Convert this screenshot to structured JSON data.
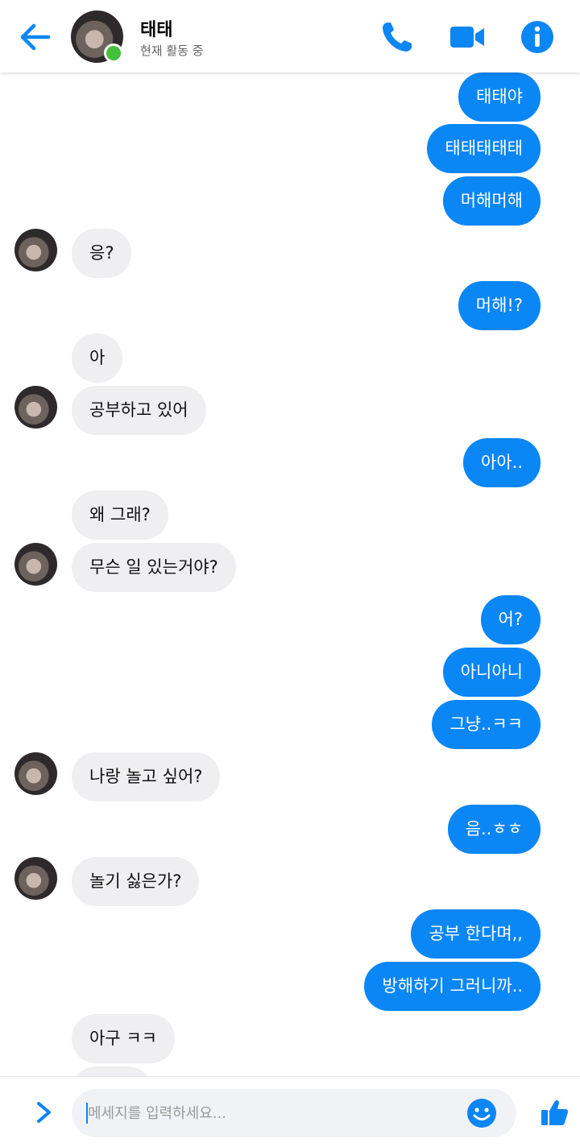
{
  "header": {
    "contact_name": "태태",
    "status": "현재 활동 중"
  },
  "messages": [
    {
      "side": "out",
      "text": "태태야"
    },
    {
      "side": "out",
      "text": "태태태태태"
    },
    {
      "side": "out",
      "text": "머해머해"
    },
    {
      "side": "in",
      "text": "응?"
    },
    {
      "side": "out",
      "text": "머해!?"
    },
    {
      "side": "in",
      "text": "아"
    },
    {
      "side": "in",
      "text": "공부하고 있어"
    },
    {
      "side": "out",
      "text": "아아.."
    },
    {
      "side": "in",
      "text": "왜 그래?"
    },
    {
      "side": "in",
      "text": "무슨 일 있는거야?"
    },
    {
      "side": "out",
      "text": "어?"
    },
    {
      "side": "out",
      "text": "아니아니"
    },
    {
      "side": "out",
      "text": "그냥..ㅋㅋ"
    },
    {
      "side": "in",
      "text": "나랑 놀고 싶어?"
    },
    {
      "side": "out",
      "text": "음..ㅎㅎ"
    },
    {
      "side": "in",
      "text": "놀기 싫은가?"
    },
    {
      "side": "out",
      "text": "공부 한다며,,"
    },
    {
      "side": "out",
      "text": "방해하기 그러니까.."
    },
    {
      "side": "in",
      "text": "아구 ㅋㅋ"
    }
  ],
  "composer": {
    "placeholder": "메세지를 입력하세요..."
  },
  "colors": {
    "accent": "#0b86f5",
    "incoming_bubble": "#efeff1",
    "online": "#44c03b"
  },
  "icons": [
    "back-arrow-icon",
    "phone-icon",
    "video-camera-icon",
    "info-icon",
    "chevron-right-icon",
    "emoji-icon",
    "thumbs-up-icon"
  ]
}
